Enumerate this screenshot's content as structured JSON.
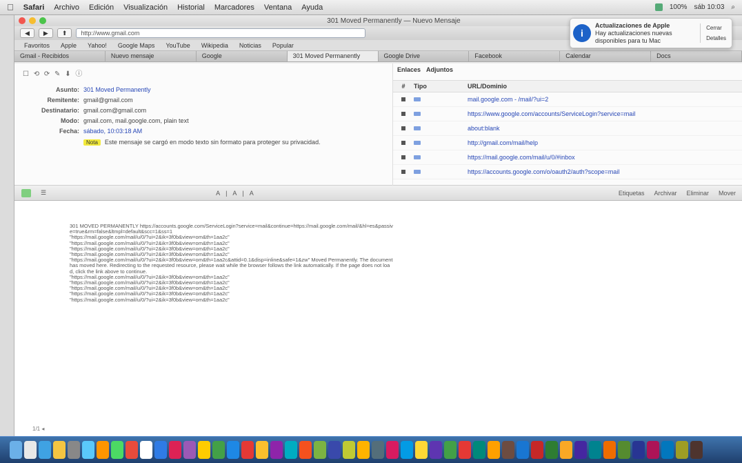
{
  "menubar": {
    "apple": "",
    "items": [
      "Safari",
      "Archivo",
      "Edición",
      "Visualización",
      "Historial",
      "Marcadores",
      "Ventana",
      "Ayuda"
    ],
    "status_time": "sáb 10:03",
    "status_extra": "100%"
  },
  "window": {
    "title": "301 Moved Permanently — Nuevo Mensaje",
    "toolbar": {
      "back": "◀",
      "forward": "▶",
      "share": "⬆",
      "url": "http://www.gmail.com"
    },
    "bookmarks": [
      "Favoritos",
      "Apple",
      "Yahoo!",
      "Google Maps",
      "YouTube",
      "Wikipedia",
      "Noticias",
      "Popular"
    ],
    "tabs": [
      {
        "label": "Gmail - Recibidos",
        "active": false
      },
      {
        "label": "Nuevo mensaje",
        "active": false
      },
      {
        "label": "Google",
        "active": false
      },
      {
        "label": "301 Moved Permanently",
        "active": true
      },
      {
        "label": "Google Drive",
        "active": false
      },
      {
        "label": "Facebook",
        "active": false
      },
      {
        "label": "Calendar",
        "active": false
      },
      {
        "label": "Docs",
        "active": false
      }
    ]
  },
  "notification": {
    "icon": "i",
    "title": "Actualizaciones de Apple",
    "body": "Hay actualizaciones nuevas disponibles para tu Mac",
    "btn_close": "Cerrar",
    "btn_details": "Detalles"
  },
  "message": {
    "toolbar_icons": "☐ ⟲ ⟳ ✎ ⬇ ⓘ",
    "fields": [
      {
        "label": "Asunto:",
        "value": "301 Moved Permanently",
        "link": true
      },
      {
        "label": "Remitente:",
        "value": "gmail@gmail.com",
        "link": false
      },
      {
        "label": "Destinatario:",
        "value": "gmail.com@gmail.com",
        "link": false
      },
      {
        "label": "Modo:",
        "value": "gmail.com, mail.google.com, plain text",
        "link": false
      },
      {
        "label": "Fecha:",
        "value": "sábado, 10:03:18 AM",
        "link": true
      }
    ],
    "note_badge": "Nota",
    "note_text": "Este mensaje se cargó en modo texto sin formato para proteger su privacidad."
  },
  "links_panel": {
    "tabs": [
      "Enlaces",
      "Adjuntos"
    ],
    "columns": [
      "#",
      "Tipo",
      "URL/Dominio"
    ],
    "rows": [
      "mail.google.com - /mail/?ui=2",
      "https://www.google.com/accounts/ServiceLogin?service=mail",
      "about:blank",
      "http://gmail.com/mail/help",
      "https://mail.google.com/mail/u/0/#inbox",
      "https://accounts.google.com/o/oauth2/auth?scope=mail"
    ]
  },
  "mid_toolbar": {
    "left": "☰",
    "center": "A | A | A",
    "right": [
      "Etiquetas",
      "Archivar",
      "Eliminar",
      "Mover"
    ]
  },
  "body_text": "301 MOVED PERMANENTLY https://accounts.google.com/ServiceLogin?service=mail&continue=https://mail.google.com/mail/&hl=es&passive=true&rm=false&ltmpl=default&scc=1&ss=1\n\"https://mail.google.com/mail/u/0/?ui=2&ik=3f0b&view=om&th=1aa2c\"\n\"https://mail.google.com/mail/u/0/?ui=2&ik=3f0b&view=om&th=1aa2c\"\n\"https://mail.google.com/mail/u/0/?ui=2&ik=3f0b&view=om&th=1aa2c\"\n\"https://mail.google.com/mail/u/0/?ui=2&ik=3f0b&view=om&th=1aa2c\"\n\"https://mail.google.com/mail/u/0/?ui=2&ik=3f0b&view=om&th=1aa2c&attid=0.1&disp=inline&safe=1&zw\" Moved Permanently. The document has moved here. Redirecting to the requested resource, please wait while the browser follows the link automatically. If the page does not load, click the link above to continue.\n\"https://mail.google.com/mail/u/0/?ui=2&ik=3f0b&view=om&th=1aa2c\"\n\"https://mail.google.com/mail/u/0/?ui=2&ik=3f0b&view=om&th=1aa2c\"\n\"https://mail.google.com/mail/u/0/?ui=2&ik=3f0b&view=om&th=1aa2c\"\n\"https://mail.google.com/mail/u/0/?ui=2&ik=3f0b&view=om&th=1aa2c\"\n\"https://mail.google.com/mail/u/0/?ui=2&ik=3f0b&view=om&th=1aa2c\"",
  "page_num": "1/1 ◂",
  "dock": {
    "icon_colors": [
      "#6bb0e8",
      "#e8e8e8",
      "#3fa2e3",
      "#f4c542",
      "#888",
      "#5ac8fa",
      "#ff9500",
      "#4cd964",
      "#e94b3c",
      "#ffffff",
      "#2f7be5",
      "#d25",
      "#9b59b6",
      "#ffcc00",
      "#43a047",
      "#1e88e5",
      "#e53935",
      "#fbc02d",
      "#8e24aa",
      "#00acc1",
      "#f4511e",
      "#7cb342",
      "#3949ab",
      "#c0ca33",
      "#ffb300",
      "#546e7a",
      "#d81b60",
      "#039be5",
      "#fdd835",
      "#5e35b1",
      "#43a047",
      "#e53935",
      "#00897b",
      "#ffa000",
      "#6d4c41",
      "#1976d2",
      "#c62828",
      "#2e7d32",
      "#f9a825",
      "#4527a0",
      "#00838f",
      "#ef6c00",
      "#558b2f",
      "#283593",
      "#ad1457",
      "#0277bd",
      "#9e9d24",
      "#4e342e"
    ]
  }
}
